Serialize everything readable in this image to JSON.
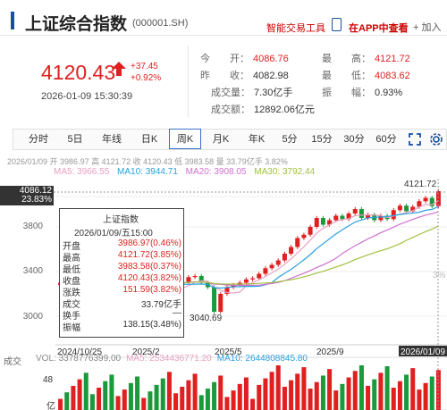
{
  "header": {
    "title": "上证综合指数",
    "code": "(000001.SH)",
    "smart_tool": "智能交易工具",
    "app_view": "在APP中查看",
    "add": "+ 加入"
  },
  "quote": {
    "price": "4120.43",
    "change": "+37.45",
    "change_pct": "+0.92%",
    "datetime": "2026-01-09 15:30:39",
    "stats": [
      {
        "label": "今　　开：",
        "value": "4086.76",
        "tone": "up"
      },
      {
        "label": "最　　高：",
        "value": "4121.72",
        "tone": "up"
      },
      {
        "label": "昨　　收：",
        "value": "4082.98",
        "tone": "neutral"
      },
      {
        "label": "最　　低：",
        "value": "4083.62",
        "tone": "up"
      },
      {
        "label": "成交量：",
        "value": "7.30亿手",
        "tone": "neutral"
      },
      {
        "label": "振　　幅：",
        "value": "0.93%",
        "tone": "neutral"
      },
      {
        "label": "成交额：",
        "value": "12892.06亿元",
        "tone": "neutral"
      }
    ]
  },
  "tabs": [
    {
      "label": "分时",
      "sup": ""
    },
    {
      "label": "5日",
      "sup": ""
    },
    {
      "label": "年线",
      "sup": ""
    },
    {
      "label": "日K",
      "sup": ""
    },
    {
      "label": "周K",
      "sup": "",
      "active": true
    },
    {
      "label": "月K",
      "sup": ""
    },
    {
      "label": "年K",
      "sup": ""
    },
    {
      "label": "5分",
      "sup": ""
    },
    {
      "label": "15分",
      "sup": ""
    },
    {
      "label": "30分",
      "sup": ""
    },
    {
      "label": "60分",
      "sup": ""
    }
  ],
  "ohlc_line": "2026/01/09 开 3986.97 高 4121.72 收 4120.43 低 3983.58 量 33.79亿手 3.82%",
  "ma_line": [
    {
      "text": "MA5: 3966.55",
      "color": "#e8a0c0"
    },
    {
      "text": "MA10: 3944.71",
      "color": "#2aa0e0"
    },
    {
      "text": "MA20: 3908.05",
      "color": "#d070d0"
    },
    {
      "text": "MA30: 3792.44",
      "color": "#a0c040"
    }
  ],
  "chart_labels": {
    "current": "4086.12",
    "current_pct": "23.83%",
    "high_label": "4121.72",
    "low_label": "3040.69",
    "volume_title": "成交",
    "volume_top": "48",
    "volume_unit": "亿",
    "right_ticks": [
      "3%"
    ]
  },
  "volume_line": [
    {
      "text": "VOL: 3378776399.00",
      "color": "#666"
    },
    {
      "text": "MA5: 2534436771.20",
      "color": "#e8a0c0"
    },
    {
      "text": "MA10: 2644808845.80",
      "color": "#2aa0e0"
    }
  ],
  "tooltip": {
    "title": "上证指数",
    "date": "2026/01/09/五15:00",
    "rows": [
      {
        "label": "开盘",
        "value": "3986.97(0.46%)",
        "tone": "up"
      },
      {
        "label": "最高",
        "value": "4121.72(3.85%)",
        "tone": "up"
      },
      {
        "label": "最低",
        "value": "3983.58(0.37%)",
        "tone": "up"
      },
      {
        "label": "收盘",
        "value": "4120.43(3.82%)",
        "tone": "up"
      },
      {
        "label": "涨跌",
        "value": "151.59(3.82%)",
        "tone": "up"
      },
      {
        "label": "成交",
        "value": "33.79亿手",
        "tone": "neutral"
      },
      {
        "label": "换手",
        "value": "—",
        "tone": "neutral"
      },
      {
        "label": "振幅",
        "value": "138.15(3.48%)",
        "tone": "neutral"
      }
    ]
  },
  "chart_data": {
    "type": "candlestick",
    "period": "weekly",
    "y_ticks": [
      3000,
      3400,
      3800
    ],
    "x_ticks": [
      "2024/10/25",
      "2025/2",
      "2025/5",
      "2025/9",
      "2026/01/09"
    ],
    "closes": [
      3300,
      3280,
      3320,
      3360,
      3300,
      3250,
      3380,
      3340,
      3290,
      3320,
      3360,
      3350,
      3280,
      3320,
      3300,
      3250,
      3200,
      3230,
      3280,
      3300,
      3350,
      3360,
      3300,
      3260,
      3040,
      3200,
      3260,
      3280,
      3300,
      3330,
      3340,
      3380,
      3430,
      3460,
      3500,
      3560,
      3620,
      3700,
      3730,
      3800,
      3880,
      3820,
      3860,
      3900,
      3870,
      3920,
      3960,
      3880,
      3910,
      3860,
      3900,
      3870,
      3950,
      3990,
      3940,
      3980,
      4030,
      4060,
      3986,
      4120
    ],
    "volume_max": 48,
    "volume_unit": "亿"
  }
}
